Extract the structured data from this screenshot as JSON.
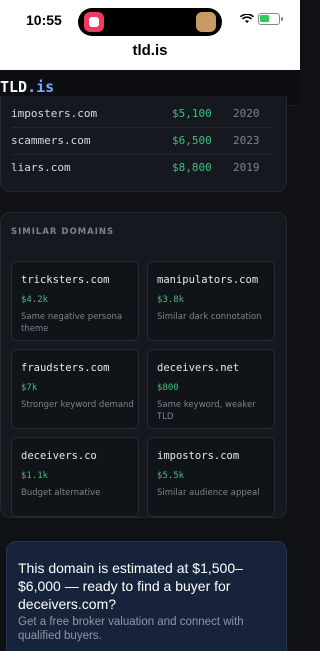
{
  "status_bar": {
    "time": "10:55"
  },
  "browser": {
    "url": "tld.is"
  },
  "site": {
    "logo_main": "TLD",
    "logo_suffix": ".is"
  },
  "recent_sales": [
    {
      "domain": "imposters.com",
      "price": "$5,100",
      "year": "2020"
    },
    {
      "domain": "scammers.com",
      "price": "$6,500",
      "year": "2023"
    },
    {
      "domain": "liars.com",
      "price": "$8,800",
      "year": "2019"
    }
  ],
  "similar": {
    "title": "SIMILAR DOMAINS",
    "items": [
      {
        "name": "tricksters.com",
        "value": "$4.2k",
        "note": "Same negative persona theme"
      },
      {
        "name": "manipulators.com",
        "value": "$3.8k",
        "note": "Similar dark connotation"
      },
      {
        "name": "fraudsters.com",
        "value": "$7k",
        "note": "Stronger keyword demand"
      },
      {
        "name": "deceivers.net",
        "value": "$800",
        "note": "Same keyword, weaker TLD"
      },
      {
        "name": "deceivers.co",
        "value": "$1.1k",
        "note": "Budget alternative"
      },
      {
        "name": "impostors.com",
        "value": "$5.5k",
        "note": "Similar audience appeal"
      }
    ]
  },
  "cta": {
    "headline": "This domain is estimated at $1,500–$6,000 — ready to find a buyer for deceivers.com?",
    "subtext": "Get a free broker valuation and connect with qualified buyers."
  },
  "colors": {
    "price_green": "#3fbf7f",
    "accent_blue": "#7aa7ff",
    "background": "#0f1115"
  }
}
